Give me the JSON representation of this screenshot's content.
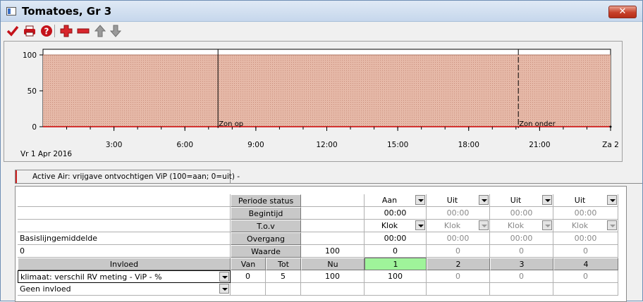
{
  "window": {
    "title": "Tomatoes, Gr 3",
    "close_label": "✕"
  },
  "toolbar": {
    "items": [
      "check-icon",
      "print-icon",
      "help-icon",
      "add-icon",
      "remove-icon",
      "move-up-icon",
      "move-down-icon"
    ]
  },
  "chart_data": {
    "type": "area",
    "title": "",
    "xlabel": "",
    "ylabel": "",
    "date_label": "Vr  1 Apr 2016",
    "y_ticks": [
      "100",
      "50",
      "0"
    ],
    "ylim": [
      0,
      100
    ],
    "x_ticks": [
      "3:00",
      "6:00",
      "9:00",
      "12:00",
      "15:00",
      "18:00",
      "21:00",
      "Za 2"
    ],
    "x_tick_hours": [
      3,
      6,
      9,
      12,
      15,
      18,
      21,
      24
    ],
    "xlim_hours": [
      0,
      24
    ],
    "x_hours": [
      0,
      24
    ],
    "band_values": [
      100,
      100
    ],
    "line_values": [
      0,
      0
    ],
    "fill_color": "#e8b4a4",
    "line_color": "#cc0000",
    "markers": [
      {
        "label": "Zon op",
        "hour": 7.4
      },
      {
        "label": "Zon onder",
        "hour": 20.1
      }
    ],
    "grid": false
  },
  "tab": {
    "label": "Active Air: vrijgave ontvochtigen ViP (100=aan; 0=uit) -"
  },
  "table": {
    "row_labels": {
      "periode_status": "Periode status",
      "begintijd": "Begintijd",
      "tov": "T.o.v",
      "overgang": "Overgang",
      "waarde": "Waarde"
    },
    "left": {
      "basislijn_label": "Basislijngemiddelde",
      "basislijn_value": "0",
      "invloed_header": "Invloed",
      "invloed_1": "klimaat: verschil RV meting - ViP - %",
      "invloed_2": "Geen invloed"
    },
    "headers": {
      "van": "Van",
      "tot": "Tot",
      "nu": "Nu"
    },
    "waarde_nu": "100",
    "periods": [
      {
        "num": "1",
        "status": "Aan",
        "begintijd": "00:00",
        "tov": "Klok",
        "overgang": "00:00",
        "waarde": "0",
        "row1": "100"
      },
      {
        "num": "2",
        "status": "Uit",
        "begintijd": "00:00",
        "tov": "Klok",
        "overgang": "00:00",
        "waarde": "0",
        "row1": "0"
      },
      {
        "num": "3",
        "status": "Uit",
        "begintijd": "00:00",
        "tov": "Klok",
        "overgang": "00:00",
        "waarde": "0",
        "row1": "0"
      },
      {
        "num": "4",
        "status": "Uit",
        "begintijd": "00:00",
        "tov": "Klok",
        "overgang": "00:00",
        "waarde": "0",
        "row1": "0"
      }
    ],
    "row1": {
      "van": "0",
      "tot": "5",
      "nu": "100"
    }
  }
}
